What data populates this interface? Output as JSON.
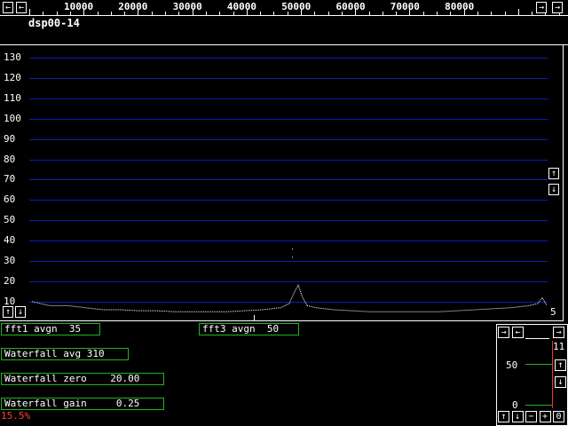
{
  "top_scale": {
    "labels": [
      "10000",
      "20000",
      "30000",
      "40000",
      "50000",
      "60000",
      "70000",
      "80000"
    ],
    "left_arrow": "←",
    "right_arrow": "→",
    "far_right_arrow": "→",
    "scroll_left": "←"
  },
  "window_title": "dsp00-14",
  "chart_data": {
    "type": "line",
    "yticks": [
      "130",
      "120",
      "110",
      "100",
      "90",
      "80",
      "70",
      "60",
      "50",
      "40",
      "30",
      "20",
      "10"
    ],
    "ylim": [
      5,
      135
    ],
    "colors": {
      "grid": "#0a1fb0",
      "trace": "#ffffff",
      "box": "#1fb51f",
      "warning": "#ff4040"
    },
    "x": [
      0,
      20,
      40,
      60,
      80,
      100,
      120,
      140,
      160,
      180,
      200,
      220,
      240,
      260,
      280,
      290,
      295,
      300,
      305,
      310,
      320,
      340,
      360,
      380,
      400,
      420,
      440,
      460,
      480,
      500,
      520,
      540,
      560,
      570,
      575,
      580
    ],
    "values": [
      10,
      8,
      8,
      7,
      6,
      6,
      5.5,
      5.5,
      5,
      5,
      5,
      5,
      5.5,
      6,
      7,
      9,
      14,
      18,
      12,
      8,
      7,
      6,
      5.5,
      5,
      5,
      5,
      5,
      5,
      5.5,
      6,
      6.5,
      7,
      8,
      9,
      12,
      8
    ],
    "peak_points": [
      {
        "x": 293,
        "y": 36
      },
      {
        "x": 293,
        "y": 32
      }
    ]
  },
  "right_scroll": {
    "up": "↑",
    "down": "↓"
  },
  "bottom_left_scroll": {
    "up": "↑",
    "down": "↓"
  },
  "right_value": "5",
  "controls": {
    "fft1": "fft1 avgn  35",
    "fft3": "fft3 avgn  50",
    "wf_avg": "Waterfall avg 310",
    "wf_zero": "Waterfall zero    20.00",
    "wf_gain": "Waterfall gain     0.25",
    "percent": "15.5%"
  },
  "mini_panel": {
    "top_label": "11",
    "mid_label": "50",
    "bottom_label": "0",
    "btn_right": "→",
    "btn_left": "←",
    "btn_right2": "→",
    "btn_up": "↑",
    "btn_down": "↓",
    "bottom_buttons": [
      "↑",
      "↓",
      "−",
      "+",
      "0"
    ]
  }
}
